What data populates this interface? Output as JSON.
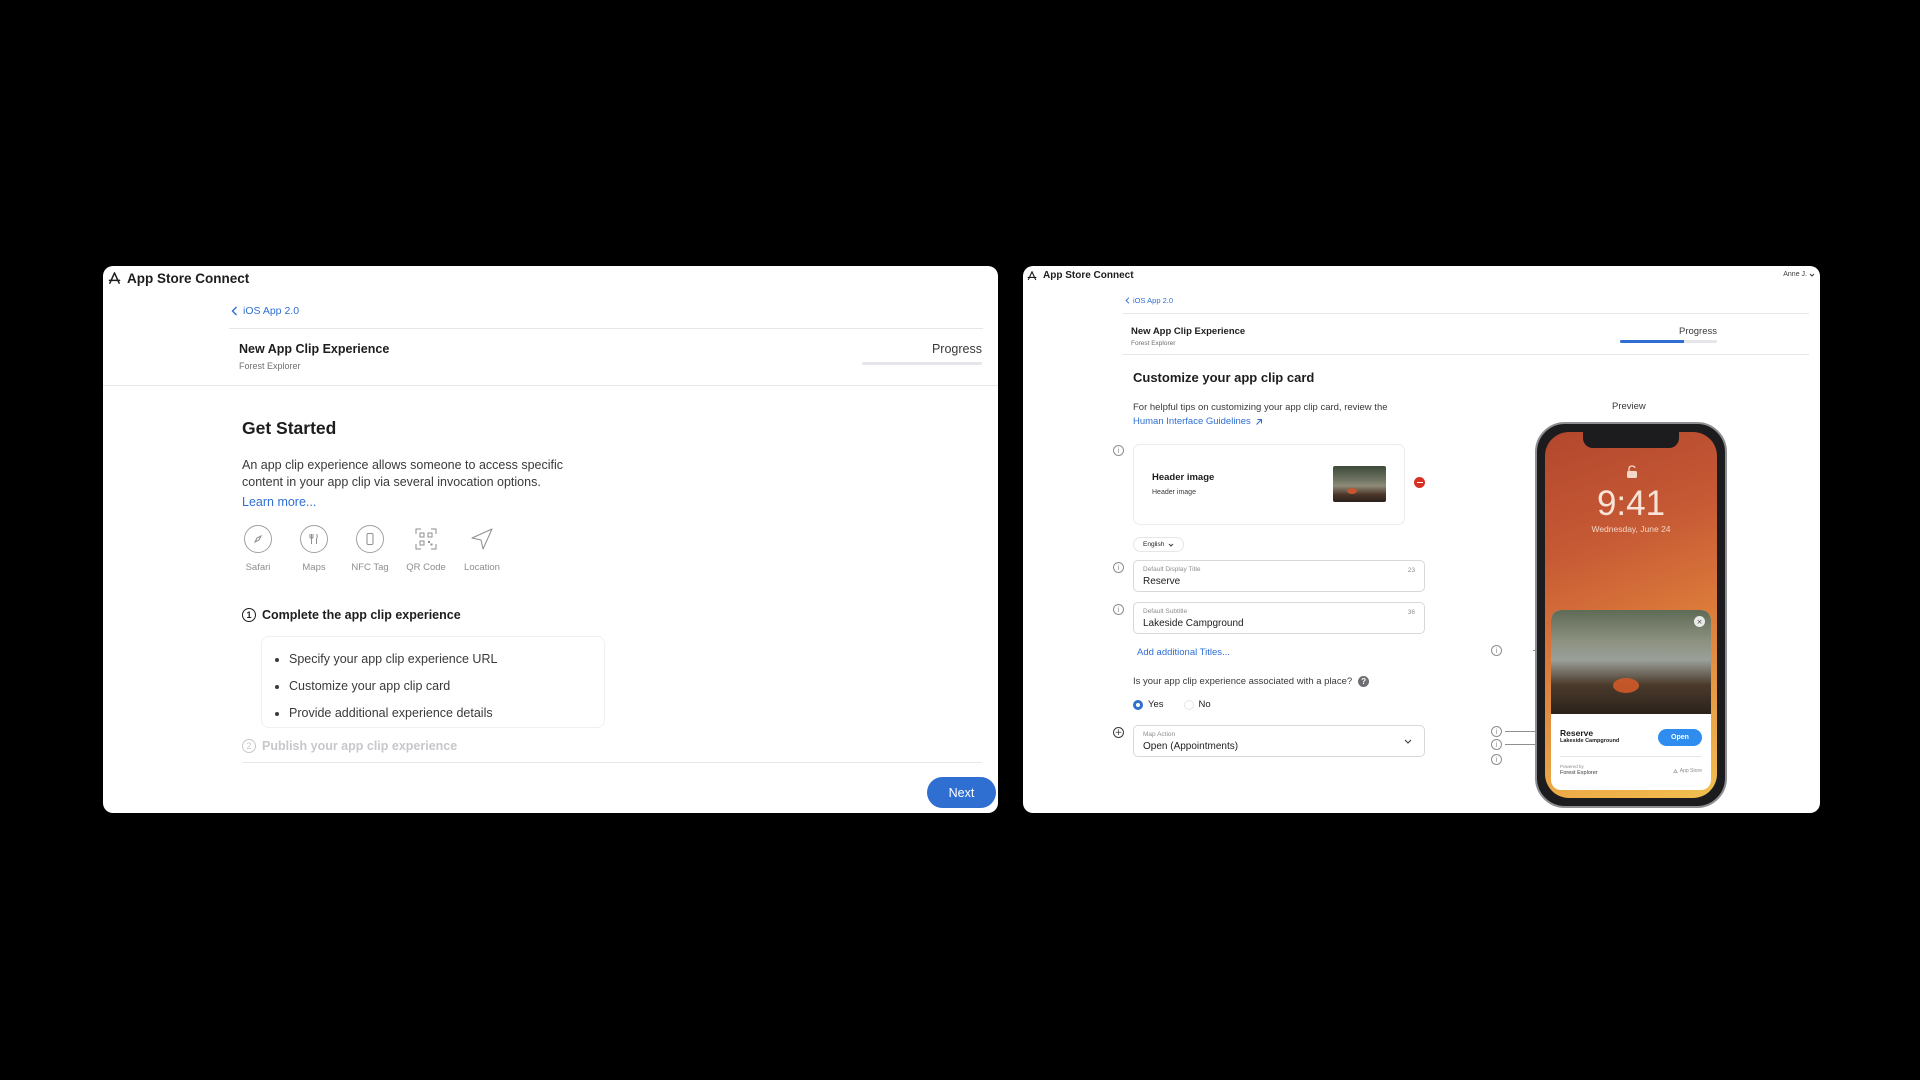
{
  "left": {
    "brand": "App Store Connect",
    "breadcrumb": "iOS App 2.0",
    "title": "New App Clip Experience",
    "subtitle": "Forest Explorer",
    "progress_label": "Progress",
    "progress": 0.0,
    "heading": "Get Started",
    "description": "An app clip experience allows someone to access specific content in your app clip via several invocation options.",
    "learn_more": "Learn more...",
    "invocations": [
      {
        "label": "Safari",
        "icon": "compass-icon"
      },
      {
        "label": "Maps",
        "icon": "fork-knife-icon"
      },
      {
        "label": "NFC Tag",
        "icon": "phone-icon"
      },
      {
        "label": "QR Code",
        "icon": "qr-code-icon"
      },
      {
        "label": "Location",
        "icon": "location-arrow-icon"
      }
    ],
    "step1": {
      "number": "1",
      "title": "Complete the app clip experience"
    },
    "bullets": [
      "Specify your app clip experience URL",
      "Customize your app clip card",
      "Provide additional experience details"
    ],
    "step2": {
      "number": "2",
      "title": "Publish your app clip experience"
    },
    "next_button": "Next"
  },
  "right": {
    "brand": "App Store Connect",
    "user": "Anne J.",
    "breadcrumb": "iOS App 2.0",
    "title": "New App Clip Experience",
    "subtitle": "Forest Explorer",
    "progress_label": "Progress",
    "progress": 0.66,
    "heading": "Customize your app clip card",
    "tip_text": "For helpful tips on customizing your app clip card, review the",
    "hig_link": "Human Interface Guidelines",
    "header_image_title": "Header image",
    "header_image_sub": "Header image",
    "language": "English",
    "title_field": {
      "label": "Default Display Title",
      "value": "Reserve",
      "count": "23"
    },
    "subtitle_field": {
      "label": "Default Subtitle",
      "value": "Lakeside Campground",
      "count": "36"
    },
    "add_titles": "Add additional Titles...",
    "place_question": "Is your app clip experience associated with a place?",
    "radio_yes": "Yes",
    "radio_no": "No",
    "map_action": {
      "label": "Map Action",
      "value": "Open (Appointments)"
    },
    "preview_label": "Preview",
    "phone": {
      "time": "9:41",
      "date": "Wednesday, June 24",
      "card_title": "Reserve",
      "card_subtitle": "Lakeside Campground",
      "open_button": "Open",
      "powered_by": "Powered by",
      "app_name": "Forest Explorer",
      "app_store": "App Store"
    }
  },
  "colors": {
    "accent": "#2f6fd2",
    "remove": "#d93025",
    "background": "#000000"
  }
}
